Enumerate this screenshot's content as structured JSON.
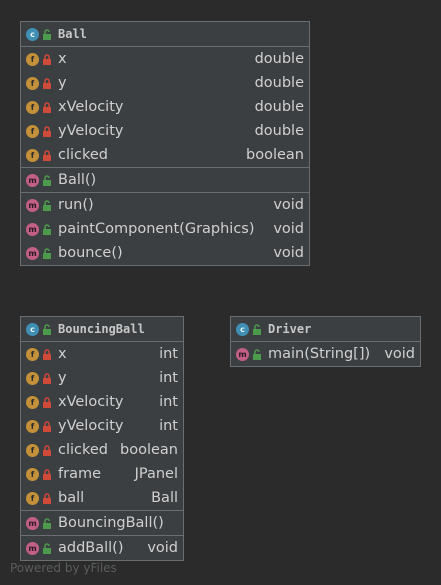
{
  "classes": {
    "ball": {
      "name": "Ball",
      "fields": [
        {
          "name": "x",
          "type": "double"
        },
        {
          "name": "y",
          "type": "double"
        },
        {
          "name": "xVelocity",
          "type": "double"
        },
        {
          "name": "yVelocity",
          "type": "double"
        },
        {
          "name": "clicked",
          "type": "boolean"
        }
      ],
      "constructors": [
        {
          "name": "Ball()",
          "type": ""
        }
      ],
      "methods": [
        {
          "name": "run()",
          "type": "void"
        },
        {
          "name": "paintComponent(Graphics)",
          "type": "void"
        },
        {
          "name": "bounce()",
          "type": "void"
        }
      ]
    },
    "bouncing_ball": {
      "name": "BouncingBall",
      "fields": [
        {
          "name": "x",
          "type": "int"
        },
        {
          "name": "y",
          "type": "int"
        },
        {
          "name": "xVelocity",
          "type": "int"
        },
        {
          "name": "yVelocity",
          "type": "int"
        },
        {
          "name": "clicked",
          "type": "boolean"
        },
        {
          "name": "frame",
          "type": "JPanel"
        },
        {
          "name": "ball",
          "type": "Ball"
        }
      ],
      "constructors": [
        {
          "name": "BouncingBall()",
          "type": ""
        }
      ],
      "methods": [
        {
          "name": "addBall()",
          "type": "void"
        }
      ]
    },
    "driver": {
      "name": "Driver",
      "methods": [
        {
          "name": "main(String[])",
          "type": "void"
        }
      ]
    }
  },
  "icons": {
    "class": "class-icon",
    "field": "field-icon",
    "method": "method-icon",
    "private": "lock-icon",
    "public": "unlocked-icon"
  },
  "colors": {
    "background": "#2b2b2b",
    "node": "#3c3f41",
    "border": "#6b6e70",
    "class_icon": "#3f8fb4",
    "field_icon": "#c4913a",
    "method_icon": "#c25f87",
    "private_lock": "#d04a3a",
    "public_lock": "#4c9a4c"
  },
  "footer": "Powered by yFiles"
}
